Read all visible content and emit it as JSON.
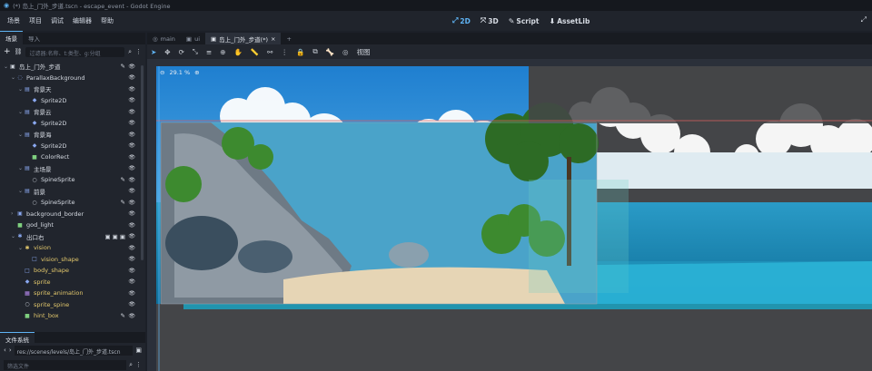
{
  "window": {
    "title": "(*) 岛上_门外_步道.tscn - escape_event - Godot Engine"
  },
  "menu": {
    "items": [
      "场景",
      "项目",
      "调试",
      "编辑器",
      "帮助"
    ]
  },
  "modes": [
    {
      "label": "2D",
      "icon": "2d-icon",
      "active": true
    },
    {
      "label": "3D",
      "icon": "3d-icon",
      "active": false
    },
    {
      "label": "Script",
      "icon": "script-icon",
      "active": false
    },
    {
      "label": "AssetLib",
      "icon": "assetlib-icon",
      "active": false
    }
  ],
  "dock": {
    "tabs": [
      "场景",
      "导入"
    ],
    "filter_placeholder": "过滤器:名称、t:类型、g:分组",
    "tree": [
      {
        "name": "岛上_门外_步道",
        "depth": 0,
        "icon": "node2d-icon",
        "color": "#cfd4dc",
        "arrow": "v",
        "extra": "script-icon"
      },
      {
        "name": "ParallaxBackground",
        "depth": 1,
        "icon": "parallax-icon",
        "color": "#8aa8f0",
        "arrow": "v"
      },
      {
        "name": "背景天",
        "depth": 2,
        "icon": "parallax-layer-icon",
        "color": "#8aa8f0",
        "arrow": "v"
      },
      {
        "name": "Sprite2D",
        "depth": 3,
        "icon": "sprite-icon",
        "color": "#8aa8f0"
      },
      {
        "name": "背景云",
        "depth": 2,
        "icon": "parallax-layer-icon",
        "color": "#8aa8f0",
        "arrow": "v"
      },
      {
        "name": "Sprite2D",
        "depth": 3,
        "icon": "sprite-icon",
        "color": "#8aa8f0"
      },
      {
        "name": "背景海",
        "depth": 2,
        "icon": "parallax-layer-icon",
        "color": "#8aa8f0",
        "arrow": "v"
      },
      {
        "name": "Sprite2D",
        "depth": 3,
        "icon": "sprite-icon",
        "color": "#8aa8f0"
      },
      {
        "name": "ColorRect",
        "depth": 3,
        "icon": "colorrect-icon",
        "color": "#7fd07f"
      },
      {
        "name": "主场景",
        "depth": 2,
        "icon": "parallax-layer-icon",
        "color": "#8aa8f0",
        "arrow": "v"
      },
      {
        "name": "SpineSprite",
        "depth": 3,
        "icon": "spine-icon",
        "color": "#cfd4dc",
        "extra": "script-icon"
      },
      {
        "name": "前景",
        "depth": 2,
        "icon": "parallax-layer-icon",
        "color": "#8aa8f0",
        "arrow": "v"
      },
      {
        "name": "SpineSprite",
        "depth": 3,
        "icon": "spine-icon",
        "color": "#cfd4dc",
        "extra": "script-icon"
      },
      {
        "name": "background_border",
        "depth": 1,
        "icon": "node2d-icon",
        "color": "#8aa8f0",
        "arrow": ">"
      },
      {
        "name": "god_light",
        "depth": 1,
        "icon": "colorrect-icon",
        "color": "#7fd07f"
      },
      {
        "name": "出口右",
        "depth": 1,
        "icon": "area-icon",
        "color": "#8aa8f0",
        "arrow": "v",
        "extra": "group-icons"
      },
      {
        "name": "vision",
        "depth": 2,
        "icon": "area-icon",
        "color": "#e3c86c",
        "arrow": "v",
        "yellow": true
      },
      {
        "name": "vision_shape",
        "depth": 3,
        "icon": "shape-icon",
        "color": "#8aa8f0",
        "yellow": true
      },
      {
        "name": "body_shape",
        "depth": 2,
        "icon": "shape-icon",
        "color": "#8aa8f0",
        "yellow": true
      },
      {
        "name": "sprite",
        "depth": 2,
        "icon": "sprite-icon",
        "color": "#8aa8f0",
        "yellow": true
      },
      {
        "name": "sprite_animation",
        "depth": 2,
        "icon": "animation-icon",
        "color": "#b88af0",
        "yellow": true
      },
      {
        "name": "sprite_spine",
        "depth": 2,
        "icon": "spine-icon",
        "color": "#cfd4dc",
        "yellow": true
      },
      {
        "name": "hint_box",
        "depth": 2,
        "icon": "colorrect-icon",
        "color": "#7fd07f",
        "yellow": true,
        "extra": "script-icon"
      }
    ]
  },
  "filesystem": {
    "tab": "文件系统",
    "path": "res://scenes/levels/岛上_门外_步道.tscn",
    "filter_placeholder": "筛选文件"
  },
  "editor": {
    "tabs": [
      {
        "label": "main",
        "active": false
      },
      {
        "label": "ui",
        "active": false
      },
      {
        "label": "岛上_门外_步道(*)",
        "active": true
      }
    ],
    "view_menu": "视图",
    "zoom": "29.1 %"
  }
}
